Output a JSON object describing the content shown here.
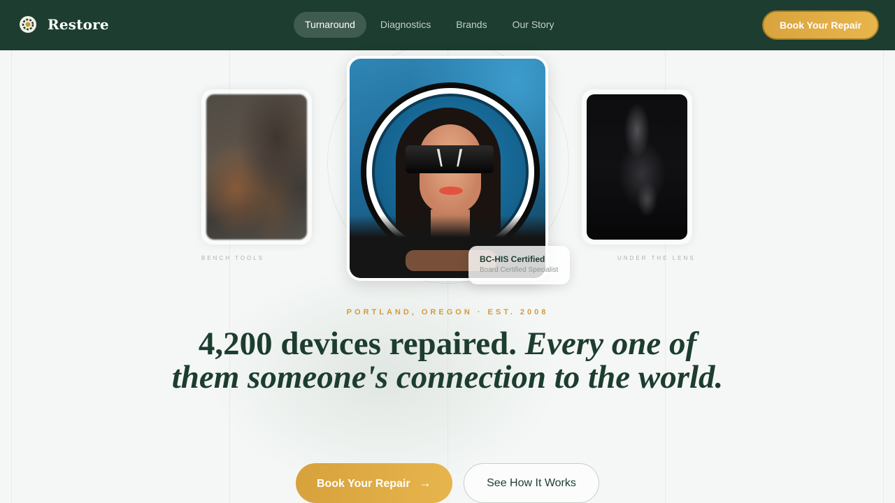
{
  "brand": {
    "name": "Restore",
    "icon": "logo-gear-icon"
  },
  "nav": {
    "links": [
      {
        "label": "Turnaround",
        "active": true
      },
      {
        "label": "Diagnostics",
        "active": false
      },
      {
        "label": "Brands",
        "active": false
      },
      {
        "label": "Our Story",
        "active": false
      }
    ],
    "cta_label": "Book Your Repair"
  },
  "gallery": {
    "left_caption": "BENCH TOOLS",
    "right_caption": "UNDER THE LENS",
    "badge": {
      "title": "BC-HIS Certified",
      "subtitle": "Board Certified Specialist"
    }
  },
  "hero": {
    "eyebrow": "PORTLAND, OREGON · EST. 2008",
    "headline_bold": "4,200 devices repaired.",
    "headline_italic": "Every one of them someone's connection to the world.",
    "primary_button": "Book Your Repair",
    "primary_icon": "arrow-right-icon",
    "secondary_button": "See How It Works"
  },
  "colors": {
    "nav_background": "#1c3d2f",
    "accent_gold": "#e0ab45",
    "page_background": "#f4f7f5",
    "headline_green": "#1c3d2f"
  }
}
